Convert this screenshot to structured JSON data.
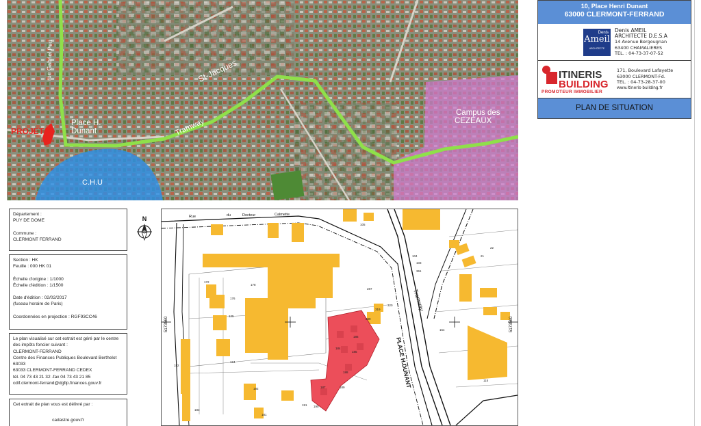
{
  "aerial_map": {
    "labels": {
      "street_top": "rue Gabriel Peri",
      "district": "St-Jacques",
      "projet": "PROJET",
      "place": "Place H.\nDunant",
      "tramway": "Tramway",
      "chu": "C.H.U",
      "campus": "Campus des\nCEZEAUX"
    },
    "colors": {
      "tram_line": "#8fe04a",
      "chu_zone": "#2d8fe6",
      "campus_zone": "#d07ad0",
      "projet": "#e8231e"
    }
  },
  "title_block": {
    "address_line1": "10, Place Henri Dunant",
    "address_line2": "63000 CLERMONT-FERRAND",
    "architect": {
      "logo_top": "Denis",
      "logo_main": "Ameil",
      "logo_sub": "ARCHITECTE",
      "name": "Denis AMEIL",
      "title": "ARCHITECTE D.E.S.A",
      "street": "14 Avenue Bergougnan",
      "city": "63400  CHAMALIERES",
      "tel": "TEL. : 04-73-37-07-52"
    },
    "promoter": {
      "logo_line1": "ITINERIS",
      "logo_line2": "BUILDING",
      "logo_tagline": "PROMOTEUR IMMOBILIER",
      "street": "171, Boulevard Lafayette",
      "city": "63000  CLERMONT-Fd.",
      "tel": "TEL. : 04-73-28-37-00",
      "web": "www.itineris-building.fr"
    },
    "plan_title": "PLAN DE SITUATION",
    "colors": {
      "header_blue": "#5b8fd6",
      "promoter_red": "#d8262c"
    }
  },
  "info": {
    "box1": [
      "Département :",
      "PUY DE DOME",
      "",
      "Commune :",
      "CLERMONT FERRAND"
    ],
    "box2": [
      "Section : HK",
      "Feuille : 000 HK 01",
      "",
      "Échelle d'origine : 1/1000",
      "Échelle d'édition : 1/1500",
      "",
      "Date d'édition : 02/02/2017",
      "(fuseau horaire de Paris)",
      "",
      "Coordonnées en projection : RGF93CC46"
    ],
    "box3": [
      "Le plan visualisé sur cet extrait est géré par le centre",
      "des impôts foncier suivant :",
      "CLERMONT-FERRAND",
      "Centre des Finances Publiques Boulevard Berthelot",
      "63033",
      "63033 CLERMONT-FERRAND CEDEX",
      "tél. 04 73 43 21 32 -fax 04 73 43 21 85",
      "cdif.clermont-ferrand@dgfip.finances.gouv.fr"
    ],
    "box4": [
      "Cet extrait de plan vous est délivré par :",
      "",
      "",
      "cadastre.gouv.fr"
    ]
  },
  "cadastre": {
    "north_label": "N",
    "street_top_a": "Rue",
    "street_top_b": "du",
    "street_top_c": "Docteur",
    "street_top_d": "Calmette",
    "street_tram": "Tramway",
    "street_place": "PLACE H.DUNANT",
    "coord_left": "5173560",
    "coord_right": "5173560",
    "parcels": [
      "105",
      "104",
      "103",
      "22",
      "21",
      "361",
      "172",
      "176",
      "178",
      "125",
      "124",
      "182",
      "183",
      "192",
      "191",
      "190",
      "181",
      "154",
      "115",
      "319",
      "320",
      "289",
      "287",
      "186",
      "185",
      "184",
      "188",
      "189",
      "187"
    ],
    "colors": {
      "building": "#f6b930",
      "projet": "#ec4e5a",
      "background": "#ffffff"
    }
  }
}
